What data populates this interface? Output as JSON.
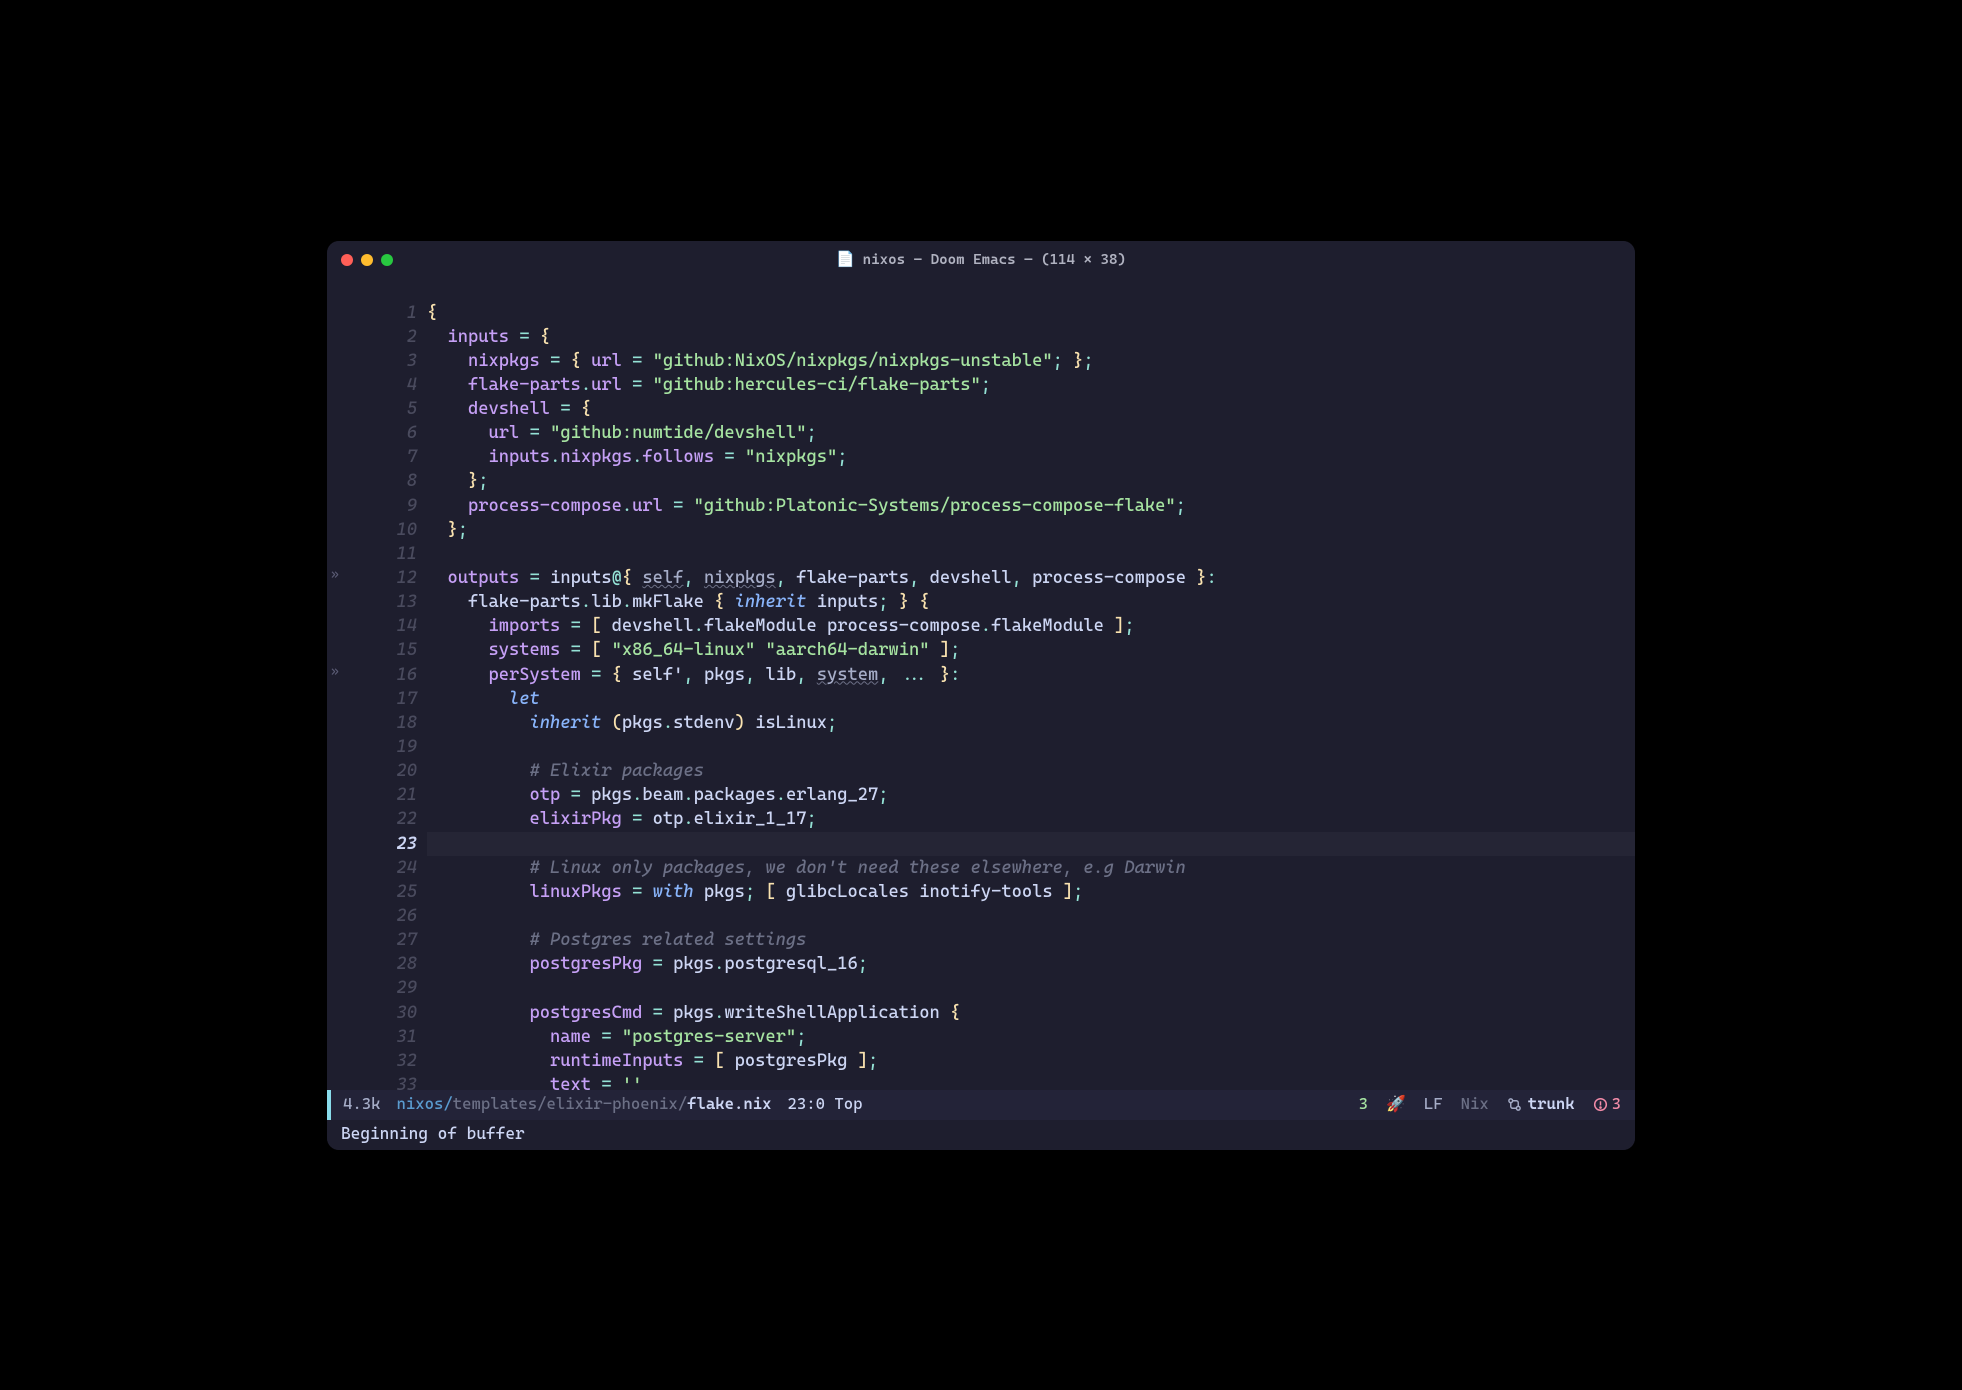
{
  "window": {
    "title": "nixos – Doom Emacs  —  (114 × 38)"
  },
  "lines": [
    {
      "n": 1,
      "fold": false,
      "current": false,
      "segs": [
        [
          "c-yellow",
          "{"
        ]
      ]
    },
    {
      "n": 2,
      "fold": false,
      "current": false,
      "segs": [
        [
          "c-fg",
          "  "
        ],
        [
          "c-purple",
          "inputs"
        ],
        [
          "c-fg",
          " "
        ],
        [
          "c-teal",
          "="
        ],
        [
          "c-fg",
          " "
        ],
        [
          "c-yellow",
          "{"
        ]
      ]
    },
    {
      "n": 3,
      "fold": false,
      "current": false,
      "segs": [
        [
          "c-fg",
          "    "
        ],
        [
          "c-purple",
          "nixpkgs"
        ],
        [
          "c-fg",
          " "
        ],
        [
          "c-teal",
          "="
        ],
        [
          "c-fg",
          " "
        ],
        [
          "c-yellow",
          "{"
        ],
        [
          "c-fg",
          " "
        ],
        [
          "c-purple",
          "url"
        ],
        [
          "c-fg",
          " "
        ],
        [
          "c-teal",
          "="
        ],
        [
          "c-fg",
          " "
        ],
        [
          "c-green",
          "\"github:NixOS/nixpkgs/nixpkgs-unstable\""
        ],
        [
          "c-teal",
          ";"
        ],
        [
          "c-fg",
          " "
        ],
        [
          "c-yellow",
          "}"
        ],
        [
          "c-teal",
          ";"
        ]
      ]
    },
    {
      "n": 4,
      "fold": false,
      "current": false,
      "segs": [
        [
          "c-fg",
          "    "
        ],
        [
          "c-purple",
          "flake-parts"
        ],
        [
          "c-teal",
          "."
        ],
        [
          "c-purple",
          "url"
        ],
        [
          "c-fg",
          " "
        ],
        [
          "c-teal",
          "="
        ],
        [
          "c-fg",
          " "
        ],
        [
          "c-green",
          "\"github:hercules-ci/flake-parts\""
        ],
        [
          "c-teal",
          ";"
        ]
      ]
    },
    {
      "n": 5,
      "fold": false,
      "current": false,
      "segs": [
        [
          "c-fg",
          "    "
        ],
        [
          "c-purple",
          "devshell"
        ],
        [
          "c-fg",
          " "
        ],
        [
          "c-teal",
          "="
        ],
        [
          "c-fg",
          " "
        ],
        [
          "c-yellow",
          "{"
        ]
      ]
    },
    {
      "n": 6,
      "fold": false,
      "current": false,
      "segs": [
        [
          "c-fg",
          "      "
        ],
        [
          "c-purple",
          "url"
        ],
        [
          "c-fg",
          " "
        ],
        [
          "c-teal",
          "="
        ],
        [
          "c-fg",
          " "
        ],
        [
          "c-green",
          "\"github:numtide/devshell\""
        ],
        [
          "c-teal",
          ";"
        ]
      ]
    },
    {
      "n": 7,
      "fold": false,
      "current": false,
      "segs": [
        [
          "c-fg",
          "      "
        ],
        [
          "c-purple",
          "inputs"
        ],
        [
          "c-teal",
          "."
        ],
        [
          "c-purple",
          "nixpkgs"
        ],
        [
          "c-teal",
          "."
        ],
        [
          "c-purple",
          "follows"
        ],
        [
          "c-fg",
          " "
        ],
        [
          "c-teal",
          "="
        ],
        [
          "c-fg",
          " "
        ],
        [
          "c-green",
          "\"nixpkgs\""
        ],
        [
          "c-teal",
          ";"
        ]
      ]
    },
    {
      "n": 8,
      "fold": false,
      "current": false,
      "segs": [
        [
          "c-fg",
          "    "
        ],
        [
          "c-yellow",
          "}"
        ],
        [
          "c-teal",
          ";"
        ]
      ]
    },
    {
      "n": 9,
      "fold": false,
      "current": false,
      "segs": [
        [
          "c-fg",
          "    "
        ],
        [
          "c-purple",
          "process-compose"
        ],
        [
          "c-teal",
          "."
        ],
        [
          "c-purple",
          "url"
        ],
        [
          "c-fg",
          " "
        ],
        [
          "c-teal",
          "="
        ],
        [
          "c-fg",
          " "
        ],
        [
          "c-green",
          "\"github:Platonic-Systems/process-compose-flake\""
        ],
        [
          "c-teal",
          ";"
        ]
      ]
    },
    {
      "n": 10,
      "fold": false,
      "current": false,
      "segs": [
        [
          "c-fg",
          "  "
        ],
        [
          "c-yellow",
          "}"
        ],
        [
          "c-teal",
          ";"
        ]
      ]
    },
    {
      "n": 11,
      "fold": false,
      "current": false,
      "segs": []
    },
    {
      "n": 12,
      "fold": true,
      "current": false,
      "segs": [
        [
          "c-fg",
          "  "
        ],
        [
          "c-purple",
          "outputs"
        ],
        [
          "c-fg",
          " "
        ],
        [
          "c-teal",
          "="
        ],
        [
          "c-fg",
          " "
        ],
        [
          "c-fg",
          "inputs"
        ],
        [
          "c-teal",
          "@"
        ],
        [
          "c-yellow",
          "{"
        ],
        [
          "c-fg",
          " "
        ],
        [
          "c-dim underline",
          "self"
        ],
        [
          "c-teal",
          ","
        ],
        [
          "c-fg",
          " "
        ],
        [
          "c-dim underline",
          "nixpkgs"
        ],
        [
          "c-teal",
          ","
        ],
        [
          "c-fg",
          " flake-parts"
        ],
        [
          "c-teal",
          ","
        ],
        [
          "c-fg",
          " devshell"
        ],
        [
          "c-teal",
          ","
        ],
        [
          "c-fg",
          " process-compose "
        ],
        [
          "c-yellow",
          "}"
        ],
        [
          "c-teal",
          ":"
        ]
      ]
    },
    {
      "n": 13,
      "fold": false,
      "current": false,
      "segs": [
        [
          "c-fg",
          "    flake-parts"
        ],
        [
          "c-teal",
          "."
        ],
        [
          "c-fg",
          "lib"
        ],
        [
          "c-teal",
          "."
        ],
        [
          "c-fg",
          "mkFlake "
        ],
        [
          "c-yellow",
          "{"
        ],
        [
          "c-fg",
          " "
        ],
        [
          "c-blue-i",
          "inherit"
        ],
        [
          "c-fg",
          " inputs"
        ],
        [
          "c-teal",
          ";"
        ],
        [
          "c-fg",
          " "
        ],
        [
          "c-yellow",
          "}"
        ],
        [
          "c-fg",
          " "
        ],
        [
          "c-yellow",
          "{"
        ]
      ]
    },
    {
      "n": 14,
      "fold": false,
      "current": false,
      "segs": [
        [
          "c-fg",
          "      "
        ],
        [
          "c-purple",
          "imports"
        ],
        [
          "c-fg",
          " "
        ],
        [
          "c-teal",
          "="
        ],
        [
          "c-fg",
          " "
        ],
        [
          "c-yellow",
          "["
        ],
        [
          "c-fg",
          " devshell"
        ],
        [
          "c-teal",
          "."
        ],
        [
          "c-fg",
          "flakeModule process-compose"
        ],
        [
          "c-teal",
          "."
        ],
        [
          "c-fg",
          "flakeModule "
        ],
        [
          "c-yellow",
          "]"
        ],
        [
          "c-teal",
          ";"
        ]
      ]
    },
    {
      "n": 15,
      "fold": false,
      "current": false,
      "segs": [
        [
          "c-fg",
          "      "
        ],
        [
          "c-purple",
          "systems"
        ],
        [
          "c-fg",
          " "
        ],
        [
          "c-teal",
          "="
        ],
        [
          "c-fg",
          " "
        ],
        [
          "c-yellow",
          "["
        ],
        [
          "c-fg",
          " "
        ],
        [
          "c-green",
          "\"x86_64-linux\""
        ],
        [
          "c-fg",
          " "
        ],
        [
          "c-green",
          "\"aarch64-darwin\""
        ],
        [
          "c-fg",
          " "
        ],
        [
          "c-yellow",
          "]"
        ],
        [
          "c-teal",
          ";"
        ]
      ]
    },
    {
      "n": 16,
      "fold": true,
      "current": false,
      "segs": [
        [
          "c-fg",
          "      "
        ],
        [
          "c-purple",
          "perSystem"
        ],
        [
          "c-fg",
          " "
        ],
        [
          "c-teal",
          "="
        ],
        [
          "c-fg",
          " "
        ],
        [
          "c-yellow",
          "{"
        ],
        [
          "c-fg",
          " self'"
        ],
        [
          "c-teal",
          ","
        ],
        [
          "c-fg",
          " pkgs"
        ],
        [
          "c-teal",
          ","
        ],
        [
          "c-fg",
          " lib"
        ],
        [
          "c-teal",
          ","
        ],
        [
          "c-fg",
          " "
        ],
        [
          "c-dim underline",
          "system"
        ],
        [
          "c-teal",
          ","
        ],
        [
          "c-fg",
          " "
        ],
        [
          "c-teal",
          "..."
        ],
        [
          "c-fg",
          " "
        ],
        [
          "c-yellow",
          "}"
        ],
        [
          "c-teal",
          ":"
        ]
      ]
    },
    {
      "n": 17,
      "fold": false,
      "current": false,
      "segs": [
        [
          "c-fg",
          "        "
        ],
        [
          "c-blue-i",
          "let"
        ]
      ]
    },
    {
      "n": 18,
      "fold": false,
      "current": false,
      "segs": [
        [
          "c-fg",
          "          "
        ],
        [
          "c-blue-i",
          "inherit"
        ],
        [
          "c-fg",
          " "
        ],
        [
          "c-yellow",
          "("
        ],
        [
          "c-fg",
          "pkgs"
        ],
        [
          "c-teal",
          "."
        ],
        [
          "c-fg",
          "stdenv"
        ],
        [
          "c-yellow",
          ")"
        ],
        [
          "c-fg",
          " isLinux"
        ],
        [
          "c-teal",
          ";"
        ]
      ]
    },
    {
      "n": 19,
      "fold": false,
      "current": false,
      "segs": []
    },
    {
      "n": 20,
      "fold": false,
      "current": false,
      "segs": [
        [
          "c-fg",
          "          "
        ],
        [
          "c-comment",
          "# Elixir packages"
        ]
      ]
    },
    {
      "n": 21,
      "fold": false,
      "current": false,
      "segs": [
        [
          "c-fg",
          "          "
        ],
        [
          "c-purple",
          "otp"
        ],
        [
          "c-fg",
          " "
        ],
        [
          "c-teal",
          "="
        ],
        [
          "c-fg",
          " pkgs"
        ],
        [
          "c-teal",
          "."
        ],
        [
          "c-fg",
          "beam"
        ],
        [
          "c-teal",
          "."
        ],
        [
          "c-fg",
          "packages"
        ],
        [
          "c-teal",
          "."
        ],
        [
          "c-fg",
          "erlang_27"
        ],
        [
          "c-teal",
          ";"
        ]
      ]
    },
    {
      "n": 22,
      "fold": false,
      "current": false,
      "segs": [
        [
          "c-fg",
          "          "
        ],
        [
          "c-purple",
          "elixirPkg"
        ],
        [
          "c-fg",
          " "
        ],
        [
          "c-teal",
          "="
        ],
        [
          "c-fg",
          " otp"
        ],
        [
          "c-teal",
          "."
        ],
        [
          "c-fg",
          "elixir_1_17"
        ],
        [
          "c-teal",
          ";"
        ]
      ]
    },
    {
      "n": 23,
      "fold": false,
      "current": true,
      "segs": []
    },
    {
      "n": 24,
      "fold": false,
      "current": false,
      "segs": [
        [
          "c-fg",
          "          "
        ],
        [
          "c-comment",
          "# Linux only packages, we don't need these elsewhere, e.g Darwin"
        ]
      ]
    },
    {
      "n": 25,
      "fold": false,
      "current": false,
      "segs": [
        [
          "c-fg",
          "          "
        ],
        [
          "c-purple",
          "linuxPkgs"
        ],
        [
          "c-fg",
          " "
        ],
        [
          "c-teal",
          "="
        ],
        [
          "c-fg",
          " "
        ],
        [
          "c-blue-i",
          "with"
        ],
        [
          "c-fg",
          " pkgs"
        ],
        [
          "c-teal",
          ";"
        ],
        [
          "c-fg",
          " "
        ],
        [
          "c-yellow",
          "["
        ],
        [
          "c-fg",
          " glibcLocales inotify-tools "
        ],
        [
          "c-yellow",
          "]"
        ],
        [
          "c-teal",
          ";"
        ]
      ]
    },
    {
      "n": 26,
      "fold": false,
      "current": false,
      "segs": []
    },
    {
      "n": 27,
      "fold": false,
      "current": false,
      "segs": [
        [
          "c-fg",
          "          "
        ],
        [
          "c-comment",
          "# Postgres related settings"
        ]
      ]
    },
    {
      "n": 28,
      "fold": false,
      "current": false,
      "segs": [
        [
          "c-fg",
          "          "
        ],
        [
          "c-purple",
          "postgresPkg"
        ],
        [
          "c-fg",
          " "
        ],
        [
          "c-teal",
          "="
        ],
        [
          "c-fg",
          " pkgs"
        ],
        [
          "c-teal",
          "."
        ],
        [
          "c-fg",
          "postgresql_16"
        ],
        [
          "c-teal",
          ";"
        ]
      ]
    },
    {
      "n": 29,
      "fold": false,
      "current": false,
      "segs": []
    },
    {
      "n": 30,
      "fold": false,
      "current": false,
      "segs": [
        [
          "c-fg",
          "          "
        ],
        [
          "c-purple",
          "postgresCmd"
        ],
        [
          "c-fg",
          " "
        ],
        [
          "c-teal",
          "="
        ],
        [
          "c-fg",
          " pkgs"
        ],
        [
          "c-teal",
          "."
        ],
        [
          "c-fg",
          "writeShellApplication "
        ],
        [
          "c-yellow",
          "{"
        ]
      ]
    },
    {
      "n": 31,
      "fold": false,
      "current": false,
      "segs": [
        [
          "c-fg",
          "            "
        ],
        [
          "c-purple",
          "name"
        ],
        [
          "c-fg",
          " "
        ],
        [
          "c-teal",
          "="
        ],
        [
          "c-fg",
          " "
        ],
        [
          "c-green",
          "\"postgres-server\""
        ],
        [
          "c-teal",
          ";"
        ]
      ]
    },
    {
      "n": 32,
      "fold": false,
      "current": false,
      "segs": [
        [
          "c-fg",
          "            "
        ],
        [
          "c-purple",
          "runtimeInputs"
        ],
        [
          "c-fg",
          " "
        ],
        [
          "c-teal",
          "="
        ],
        [
          "c-fg",
          " "
        ],
        [
          "c-yellow",
          "["
        ],
        [
          "c-fg",
          " postgresPkg "
        ],
        [
          "c-yellow",
          "]"
        ],
        [
          "c-teal",
          ";"
        ]
      ]
    },
    {
      "n": 33,
      "fold": false,
      "current": false,
      "segs": [
        [
          "c-fg",
          "            "
        ],
        [
          "c-purple",
          "text"
        ],
        [
          "c-fg",
          " "
        ],
        [
          "c-teal",
          "="
        ],
        [
          "c-fg",
          " "
        ],
        [
          "c-green",
          "''"
        ]
      ]
    }
  ],
  "modeline": {
    "size": "4.3k",
    "path_prefix": "nixos/",
    "path_dim": "templates/elixir-phoenix/",
    "path_file": "flake.nix",
    "pos": "23:0 Top",
    "lsp_count": "3",
    "encoding": "LF",
    "mode": "Nix",
    "vc_branch": "trunk",
    "err_count": "3"
  },
  "echo": "Beginning of buffer"
}
